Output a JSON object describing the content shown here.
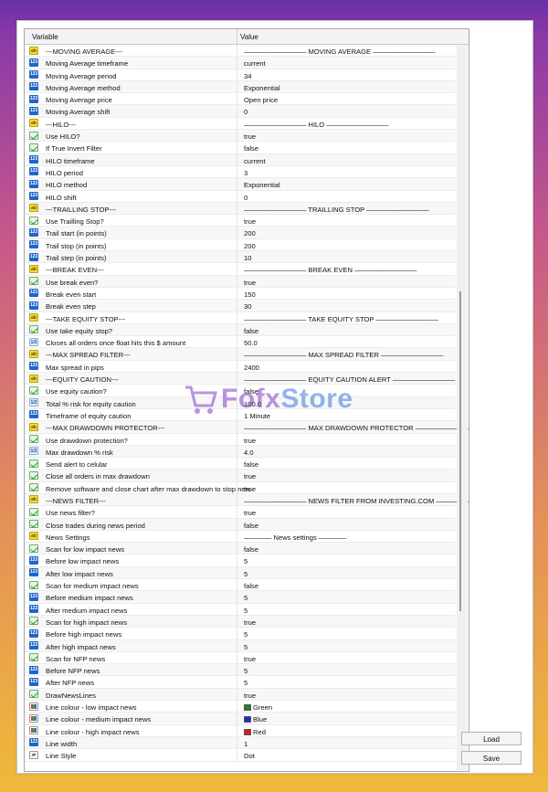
{
  "header": {
    "col_variable": "Variable",
    "col_value": "Value"
  },
  "rows": [
    {
      "icon": "ab",
      "name": "---MOVING AVERAGE---",
      "value": "————————— MOVING AVERAGE —————————"
    },
    {
      "icon": "n",
      "name": "Moving Average timeframe",
      "value": "current"
    },
    {
      "icon": "n",
      "name": "Moving Average period",
      "value": "34"
    },
    {
      "icon": "n",
      "name": "Moving Average method",
      "value": "Exponential"
    },
    {
      "icon": "n",
      "name": "Moving Average price",
      "value": "Open price"
    },
    {
      "icon": "n",
      "name": "Moving Average shift",
      "value": "0"
    },
    {
      "icon": "ab",
      "name": "---HILO---",
      "value": "————————— HILO —————————"
    },
    {
      "icon": "b",
      "name": "Use HILO?",
      "value": "true"
    },
    {
      "icon": "b",
      "name": "If True Invert Filter",
      "value": "false"
    },
    {
      "icon": "n",
      "name": "HILO timeframe",
      "value": "current"
    },
    {
      "icon": "n",
      "name": "HILO period",
      "value": "3"
    },
    {
      "icon": "n",
      "name": "HILO method",
      "value": "Exponential"
    },
    {
      "icon": "n",
      "name": "HILO shift",
      "value": "0"
    },
    {
      "icon": "ab",
      "name": "---TRAILLING STOP---",
      "value": "————————— TRAILLING STOP —————————"
    },
    {
      "icon": "b",
      "name": "Use Trailling Stop?",
      "value": "true"
    },
    {
      "icon": "n",
      "name": "Trail start    (in points)",
      "value": "200"
    },
    {
      "icon": "n",
      "name": "Trail stop     (in points)",
      "value": "200"
    },
    {
      "icon": "n",
      "name": "Trail step     (in points)",
      "value": "10"
    },
    {
      "icon": "ab",
      "name": "---BREAK EVEN---",
      "value": "————————— BREAK EVEN —————————"
    },
    {
      "icon": "b",
      "name": "Use break even?",
      "value": "true"
    },
    {
      "icon": "n",
      "name": "Break even start",
      "value": "150"
    },
    {
      "icon": "n",
      "name": "Break even step",
      "value": "30"
    },
    {
      "icon": "ab",
      "name": "---TAKE EQUITY STOP---",
      "value": "————————— TAKE EQUITY STOP —————————"
    },
    {
      "icon": "b",
      "name": "Use take equity stop?",
      "value": "false"
    },
    {
      "icon": "f",
      "name": "Closes all orders once float hits this $ amount",
      "value": "50.0"
    },
    {
      "icon": "ab",
      "name": "---MAX SPREAD FILTER---",
      "value": "————————— MAX SPREAD FILTER —————————"
    },
    {
      "icon": "n",
      "name": "Max spread in pips",
      "value": "2400"
    },
    {
      "icon": "ab",
      "name": "---EQUITY CAUTION---",
      "value": "————————— EQUITY CAUTION ALERT —————————"
    },
    {
      "icon": "b",
      "name": "Use equity caution?",
      "value": "false"
    },
    {
      "icon": "f",
      "name": "Total % risk for equity caution",
      "value": "100.0"
    },
    {
      "icon": "n",
      "name": "Timeframe of equity caution",
      "value": "1 Minute"
    },
    {
      "icon": "ab",
      "name": "---MAX DRAWDOWN PROTECTOR---",
      "value": "————————— MAX DRAWDOWN PROTECTOR —————————"
    },
    {
      "icon": "b",
      "name": "Use drawdown protection?",
      "value": "true"
    },
    {
      "icon": "f",
      "name": "Max drawdown % risk",
      "value": "4.0"
    },
    {
      "icon": "b",
      "name": "Send alert to celular",
      "value": "false"
    },
    {
      "icon": "b",
      "name": "Close all orders in max drawdown",
      "value": "true"
    },
    {
      "icon": "b",
      "name": "Remove software and close chart after max drawdown to stop new",
      "value": "true"
    },
    {
      "icon": "ab",
      "name": "---NEWS FILTER---",
      "value": "————————— NEWS FILTER FROM INVESTING.COM —————————"
    },
    {
      "icon": "b",
      "name": "Use news filter?",
      "value": "true"
    },
    {
      "icon": "b",
      "name": "Close trades during news period",
      "value": "false"
    },
    {
      "icon": "ab",
      "name": "News Settings",
      "value": "———— News settings ————"
    },
    {
      "icon": "b",
      "name": "Scan for low impact news",
      "value": "false"
    },
    {
      "icon": "n",
      "name": "Before low impact news",
      "value": "5"
    },
    {
      "icon": "n",
      "name": "After low impact news",
      "value": "5"
    },
    {
      "icon": "b",
      "name": "Scan for medium impact news",
      "value": "false"
    },
    {
      "icon": "n",
      "name": "Before medium impact news",
      "value": "5"
    },
    {
      "icon": "n",
      "name": "After medium impact news",
      "value": "5"
    },
    {
      "icon": "b",
      "name": "Scan for high impact news",
      "value": "true"
    },
    {
      "icon": "n",
      "name": "Before high impact news",
      "value": "5"
    },
    {
      "icon": "n",
      "name": "After high impact news",
      "value": "5"
    },
    {
      "icon": "b",
      "name": "Scan for NFP news",
      "value": "true"
    },
    {
      "icon": "n",
      "name": "Before NFP news",
      "value": "5"
    },
    {
      "icon": "n",
      "name": "After NFP news",
      "value": "5"
    },
    {
      "icon": "b",
      "name": "DrawNewsLines",
      "value": "true"
    },
    {
      "icon": "c",
      "name": "Line colour - low impact news",
      "value": "Green",
      "swatch": "#1a8a1a"
    },
    {
      "icon": "c",
      "name": "Line colour - medium impact news",
      "value": "Blue",
      "swatch": "#1a2ad0"
    },
    {
      "icon": "c",
      "name": "Line colour - high impact news",
      "value": "Red",
      "swatch": "#d81a1a"
    },
    {
      "icon": "n",
      "name": "Line width",
      "value": "1"
    },
    {
      "icon": "a",
      "name": "Line Style",
      "value": "Dot"
    }
  ],
  "buttons": {
    "load": "Load",
    "save": "Save"
  },
  "watermark": {
    "part1": "Fofx",
    "part2": "Store"
  }
}
